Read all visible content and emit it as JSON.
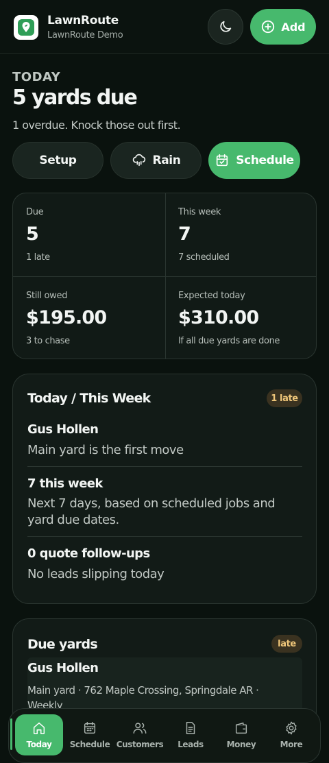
{
  "app": {
    "name": "LawnRoute",
    "subtitle": "LawnRoute Demo"
  },
  "header": {
    "add_label": "Add",
    "theme_icon": "moon-icon"
  },
  "hero": {
    "eyebrow": "TODAY",
    "headline": "5 yards due",
    "subline": "1 overdue. Knock those out first."
  },
  "actions": [
    {
      "label": "Setup",
      "icon": ""
    },
    {
      "label": "Rain",
      "icon": "rain-cloud-icon"
    },
    {
      "label": "Schedule",
      "icon": "calendar-check-icon"
    }
  ],
  "stats": [
    {
      "label": "Due",
      "value": "5",
      "note": "1 late"
    },
    {
      "label": "This week",
      "value": "7",
      "note": "7 scheduled"
    },
    {
      "label": "Still owed",
      "value": "$195.00",
      "note": "3 to chase"
    },
    {
      "label": "Expected today",
      "value": "$310.00",
      "note": "If all due yards are done"
    }
  ],
  "today_card": {
    "title": "Today / This Week",
    "badge": "1 late",
    "rows": [
      {
        "title": "Gus Hollen",
        "sub": "Main yard is the first move"
      },
      {
        "title": "7 this week",
        "sub": "Next 7 days, based on scheduled jobs and yard due dates."
      },
      {
        "title": "0 quote follow-ups",
        "sub": "No leads slipping today"
      }
    ]
  },
  "due_card": {
    "title": "Due yards",
    "badge": "late",
    "item": {
      "name": "Gus Hollen",
      "detail": "Main yard · 762 Maple Crossing, Springdale AR · Weekly"
    }
  },
  "nav": [
    {
      "label": "Today",
      "icon": "home-icon"
    },
    {
      "label": "Schedule",
      "icon": "calendar-icon"
    },
    {
      "label": "Customers",
      "icon": "users-icon"
    },
    {
      "label": "Leads",
      "icon": "document-icon"
    },
    {
      "label": "Money",
      "icon": "wallet-icon"
    },
    {
      "label": "More",
      "icon": "gear-icon"
    }
  ],
  "colors": {
    "accent": "#47b96d",
    "background": "#0a120e",
    "badge": "#f0c77a"
  }
}
